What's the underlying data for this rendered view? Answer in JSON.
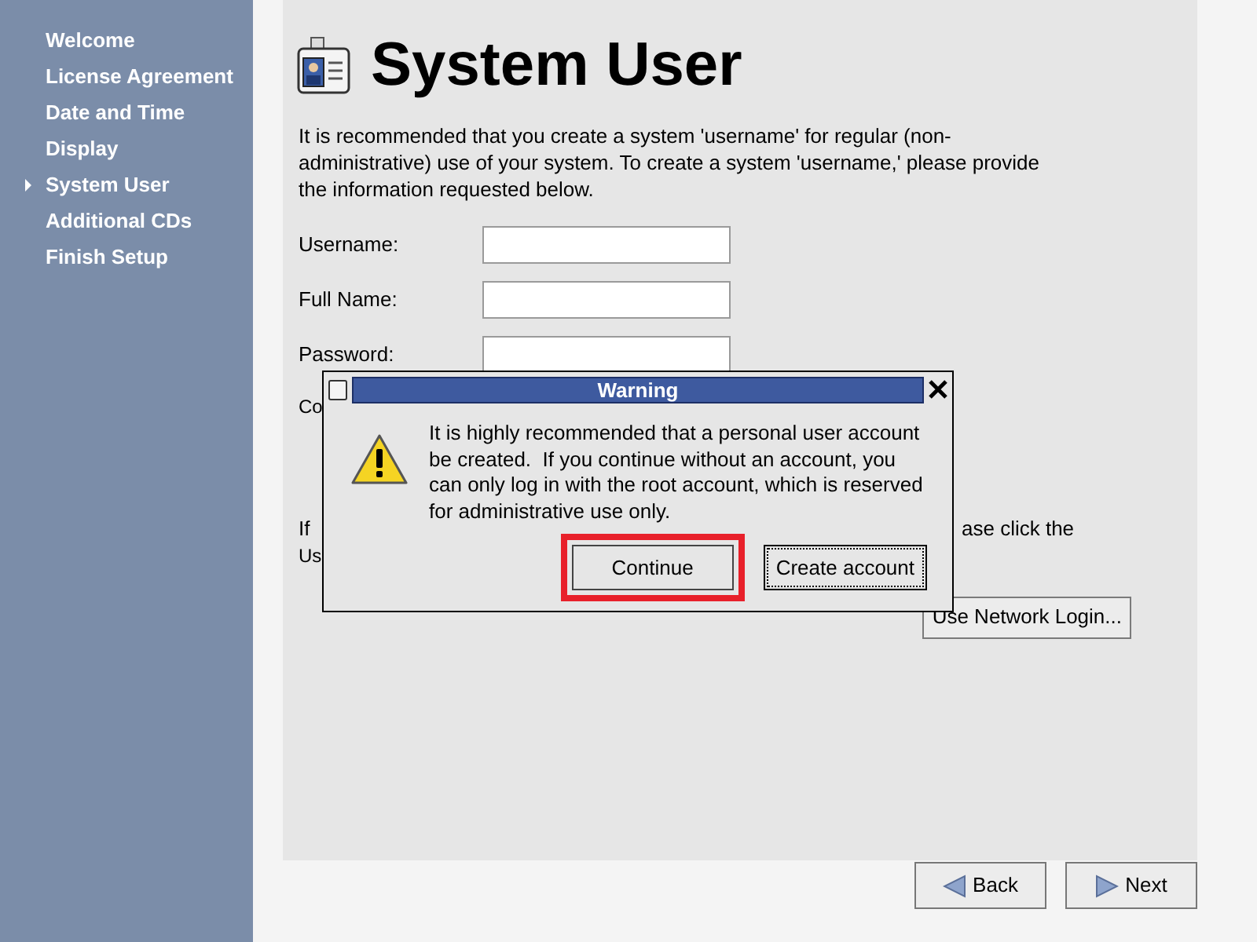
{
  "sidebar": {
    "items": [
      {
        "label": "Welcome",
        "selected": false
      },
      {
        "label": "License Agreement",
        "selected": false
      },
      {
        "label": "Date and Time",
        "selected": false
      },
      {
        "label": "Display",
        "selected": false
      },
      {
        "label": "System User",
        "selected": true
      },
      {
        "label": "Additional CDs",
        "selected": false
      },
      {
        "label": "Finish Setup",
        "selected": false
      }
    ]
  },
  "page": {
    "title": "System User",
    "intro": "It is recommended that you create a system 'username' for regular (non-administrative) use of your system. To create a system 'username,' please provide the information requested below.",
    "fields": [
      {
        "label": "Username:"
      },
      {
        "label": "Full Name:"
      },
      {
        "label": "Password:"
      }
    ],
    "confirm_label_visible": "Co",
    "network_note": {
      "line_1_start": "If",
      "line_1_end": "ase click the",
      "line_2_start": "Us"
    },
    "network_button": {
      "label": "Use Network Login..."
    }
  },
  "dialog": {
    "title": "Warning",
    "message": "It is highly recommended that a personal user account be created.  If you continue without an account, you can only log in with the root account, which is reserved for administrative use only.",
    "buttons": [
      {
        "label": "Continue",
        "highlighted": true
      },
      {
        "label": "Create account",
        "highlighted": false
      }
    ]
  },
  "nav": [
    {
      "kind": "back",
      "label": "Back"
    },
    {
      "kind": "next",
      "label": "Next"
    }
  ]
}
